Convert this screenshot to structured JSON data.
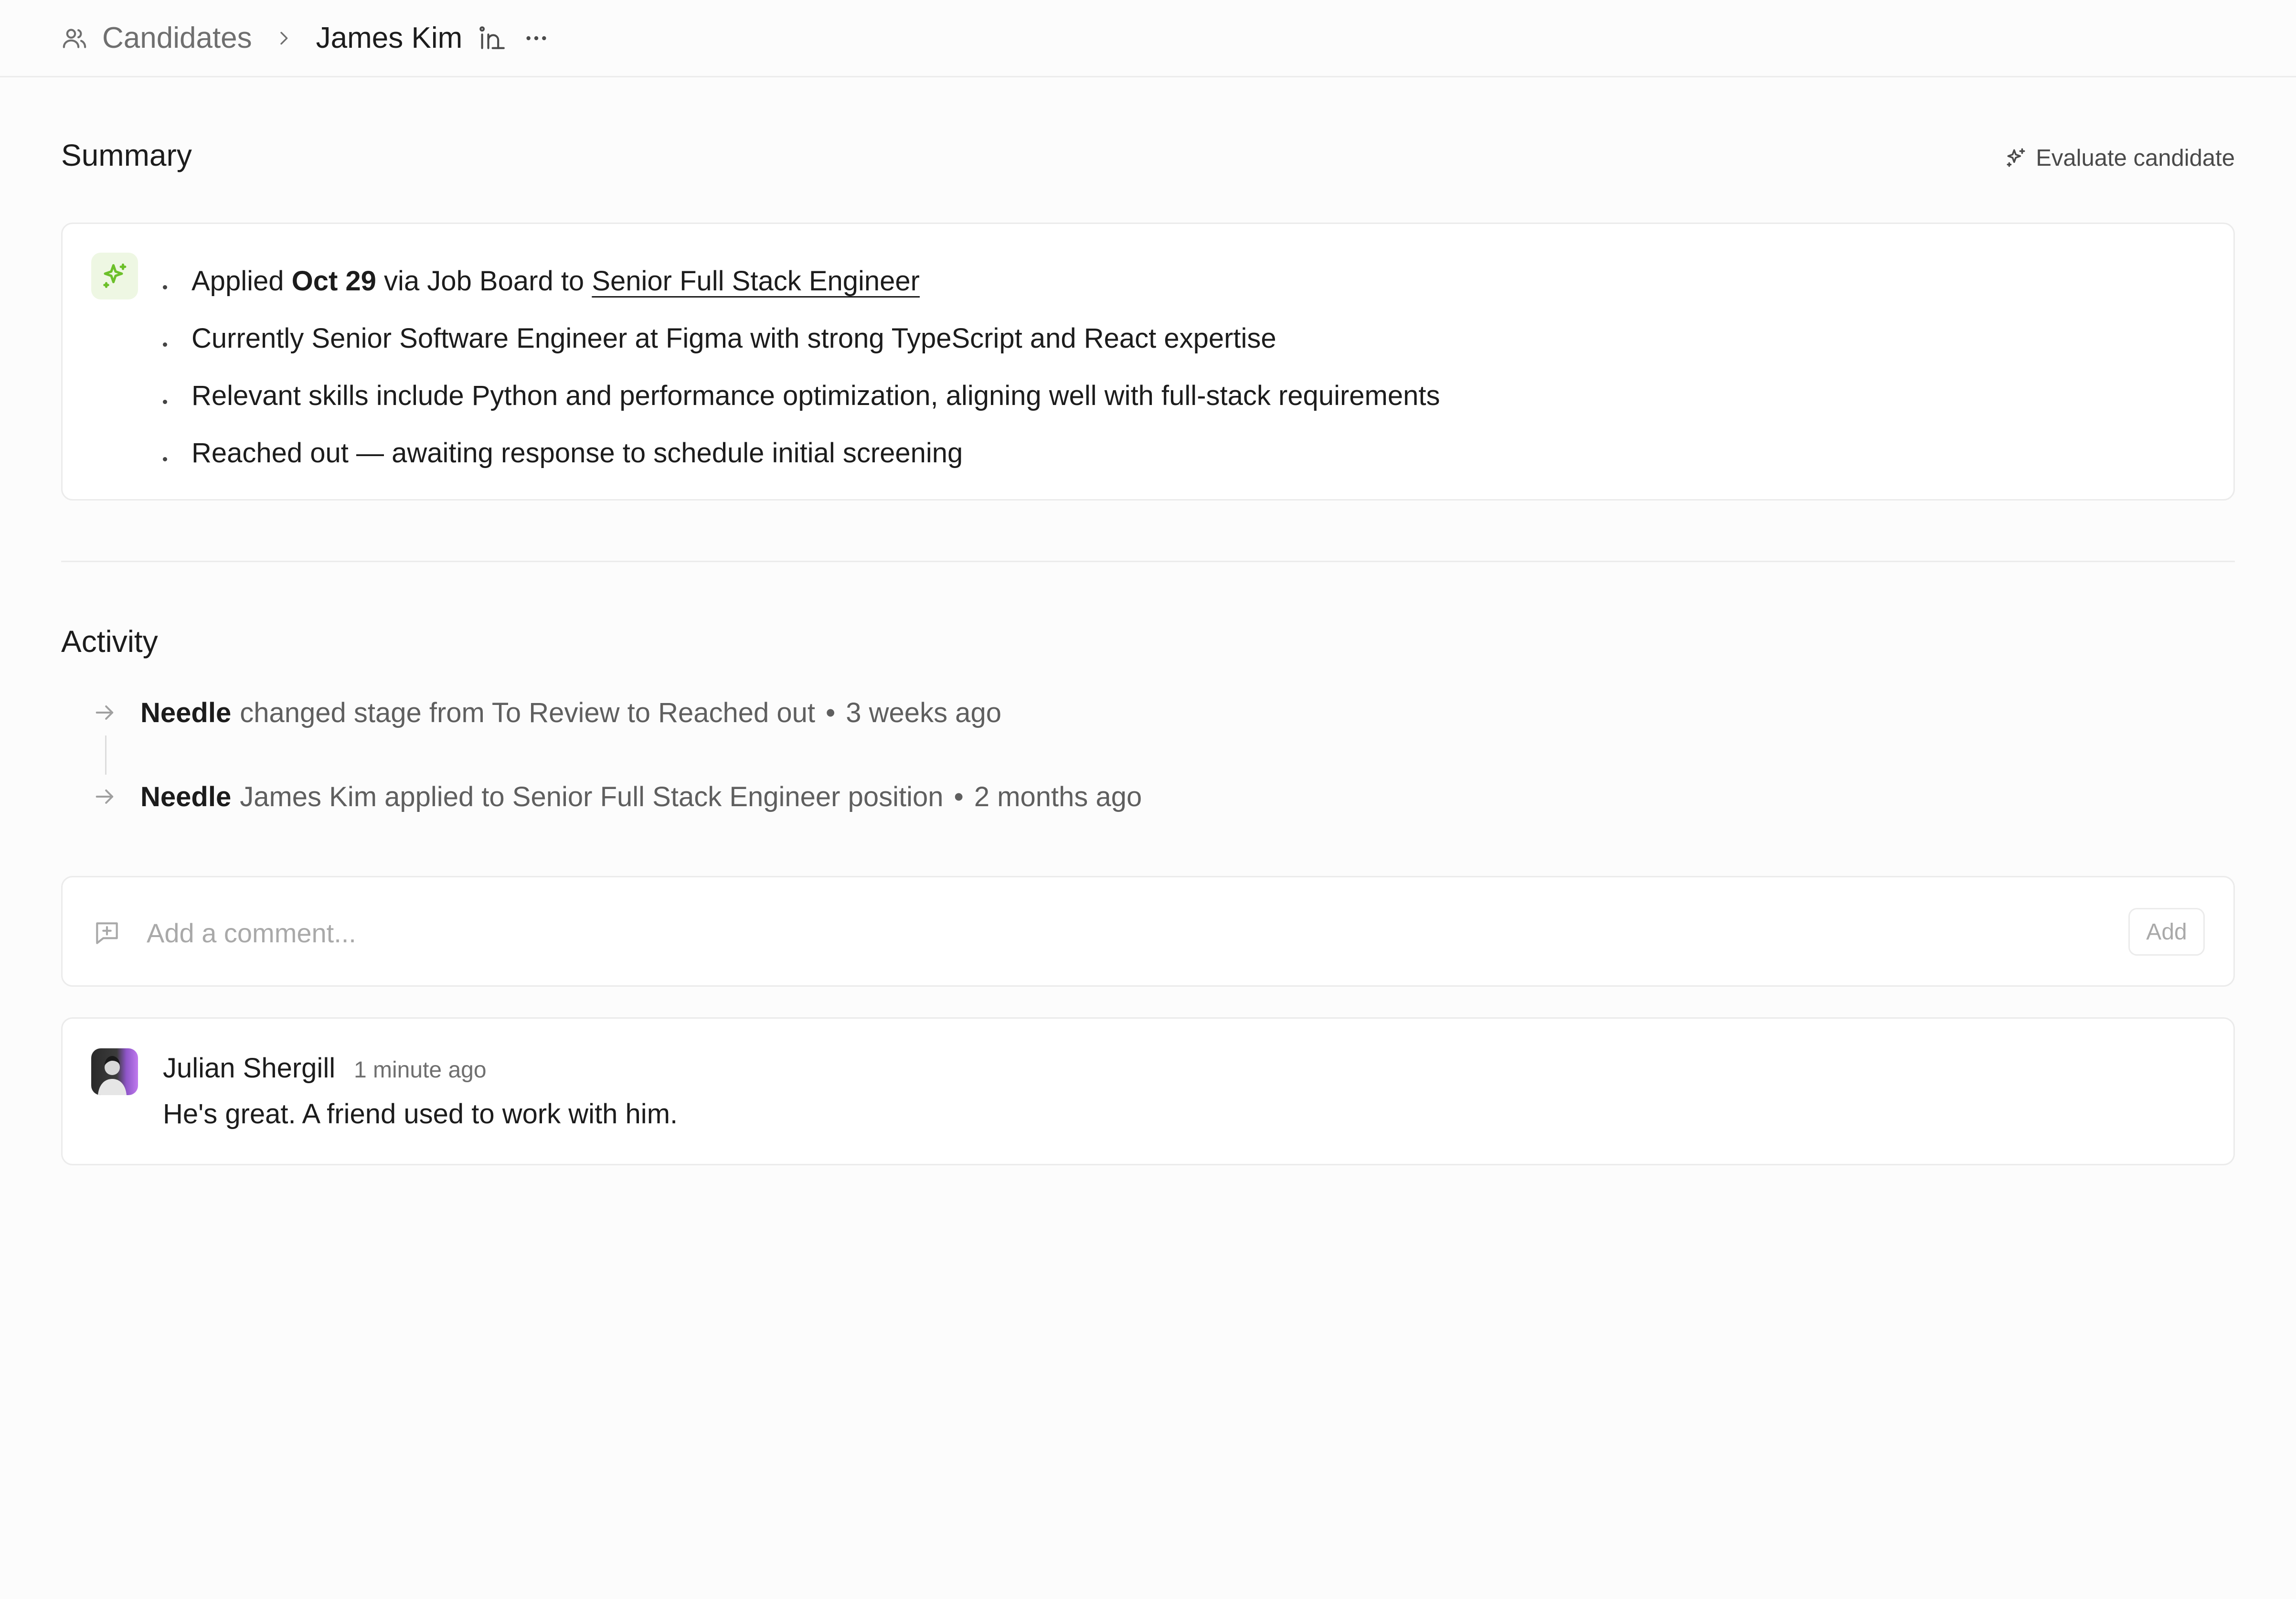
{
  "breadcrumb": {
    "parent_label": "Candidates",
    "current_label": "James Kim"
  },
  "summary": {
    "title": "Summary",
    "evaluate_label": "Evaluate candidate",
    "bullets": {
      "applied_prefix": "Applied ",
      "applied_date": "Oct 29",
      "applied_middle": " via Job Board to ",
      "applied_job": "Senior Full Stack Engineer",
      "line2": "Currently Senior Software Engineer at Figma with strong TypeScript and React expertise",
      "line3": "Relevant skills include Python and performance optimization, aligning well with full-stack requirements",
      "line4": "Reached out — awaiting response to schedule initial screening"
    }
  },
  "activity": {
    "title": "Activity",
    "items": [
      {
        "actor": "Needle",
        "text": "changed stage from To Review to Reached out",
        "separator": "•",
        "time": "3 weeks ago"
      },
      {
        "actor": "Needle",
        "text": "James Kim applied to Senior Full Stack Engineer position",
        "separator": "•",
        "time": "2 months ago"
      }
    ]
  },
  "comment_box": {
    "placeholder": "Add a comment...",
    "add_label": "Add"
  },
  "comments": [
    {
      "author": "Julian Shergill",
      "time": "1 minute ago",
      "body": "He's great. A friend used to work with him."
    }
  ],
  "icons": {
    "breadcrumb": "users-icon",
    "separator": "chevron-right-icon",
    "social": "linkedin-icon",
    "more": "more-horizontal-icon",
    "evaluate": "sparkles-icon",
    "ai_badge": "sparkles-icon",
    "activity": "arrow-right-icon",
    "comment": "message-plus-icon"
  },
  "colors": {
    "accent_green": "#6cc02a",
    "ai_badge_bg": "#eef7e3",
    "avatar_purple": "#b06be0"
  }
}
